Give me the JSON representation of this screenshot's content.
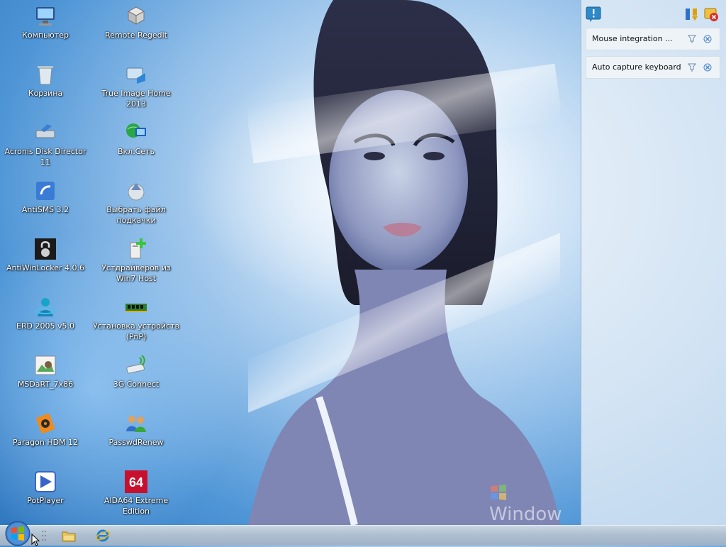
{
  "desktop": {
    "icons": [
      {
        "label": "Компьютер",
        "icon": "computer-icon"
      },
      {
        "label": "Remote Regedit",
        "icon": "regedit-icon"
      },
      {
        "label": "Корзина",
        "icon": "recycle-bin-icon"
      },
      {
        "label": "True Image Home 2013",
        "icon": "true-image-icon"
      },
      {
        "label": "Acronis Disk Director 11",
        "icon": "disk-director-icon"
      },
      {
        "label": "Вкл.Сеть",
        "icon": "network-globe-icon"
      },
      {
        "label": "AntiSMS 3.2",
        "icon": "antisms-icon"
      },
      {
        "label": "Выбрать файл подкачки",
        "icon": "pagefile-icon"
      },
      {
        "label": "AntiWinLocker 4.0.6",
        "icon": "padlock-icon"
      },
      {
        "label": "Устдрайверов из Win7 Host",
        "icon": "driver-install-icon"
      },
      {
        "label": "ERD 2005 v5.0",
        "icon": "erd-icon"
      },
      {
        "label": "Установка устройств (PnP)",
        "icon": "memory-module-icon"
      },
      {
        "label": "MSDaRT_7x86",
        "icon": "msdart-icon"
      },
      {
        "label": "3G Connect",
        "icon": "usb-modem-icon"
      },
      {
        "label": "Paragon HDM 12",
        "icon": "paragon-icon"
      },
      {
        "label": "PasswdRenew",
        "icon": "users-icon"
      },
      {
        "label": "PotPlayer",
        "icon": "potplayer-icon"
      },
      {
        "label": "AIDA64 Extreme Edition",
        "icon": "aida64-icon",
        "badge": "64"
      }
    ],
    "watermark": "Window"
  },
  "notifications": {
    "items": [
      {
        "text": "Mouse integration ..."
      },
      {
        "text": "Auto capture keyboard ..."
      }
    ]
  },
  "taskbar": {
    "items": [
      "start-orb-icon",
      "explorer-folder-icon",
      "internet-explorer-icon"
    ]
  },
  "colors": {
    "accent": "#2c74bd",
    "panel_bg": "#e8f0f7",
    "taskbar": "#aebfd0"
  }
}
